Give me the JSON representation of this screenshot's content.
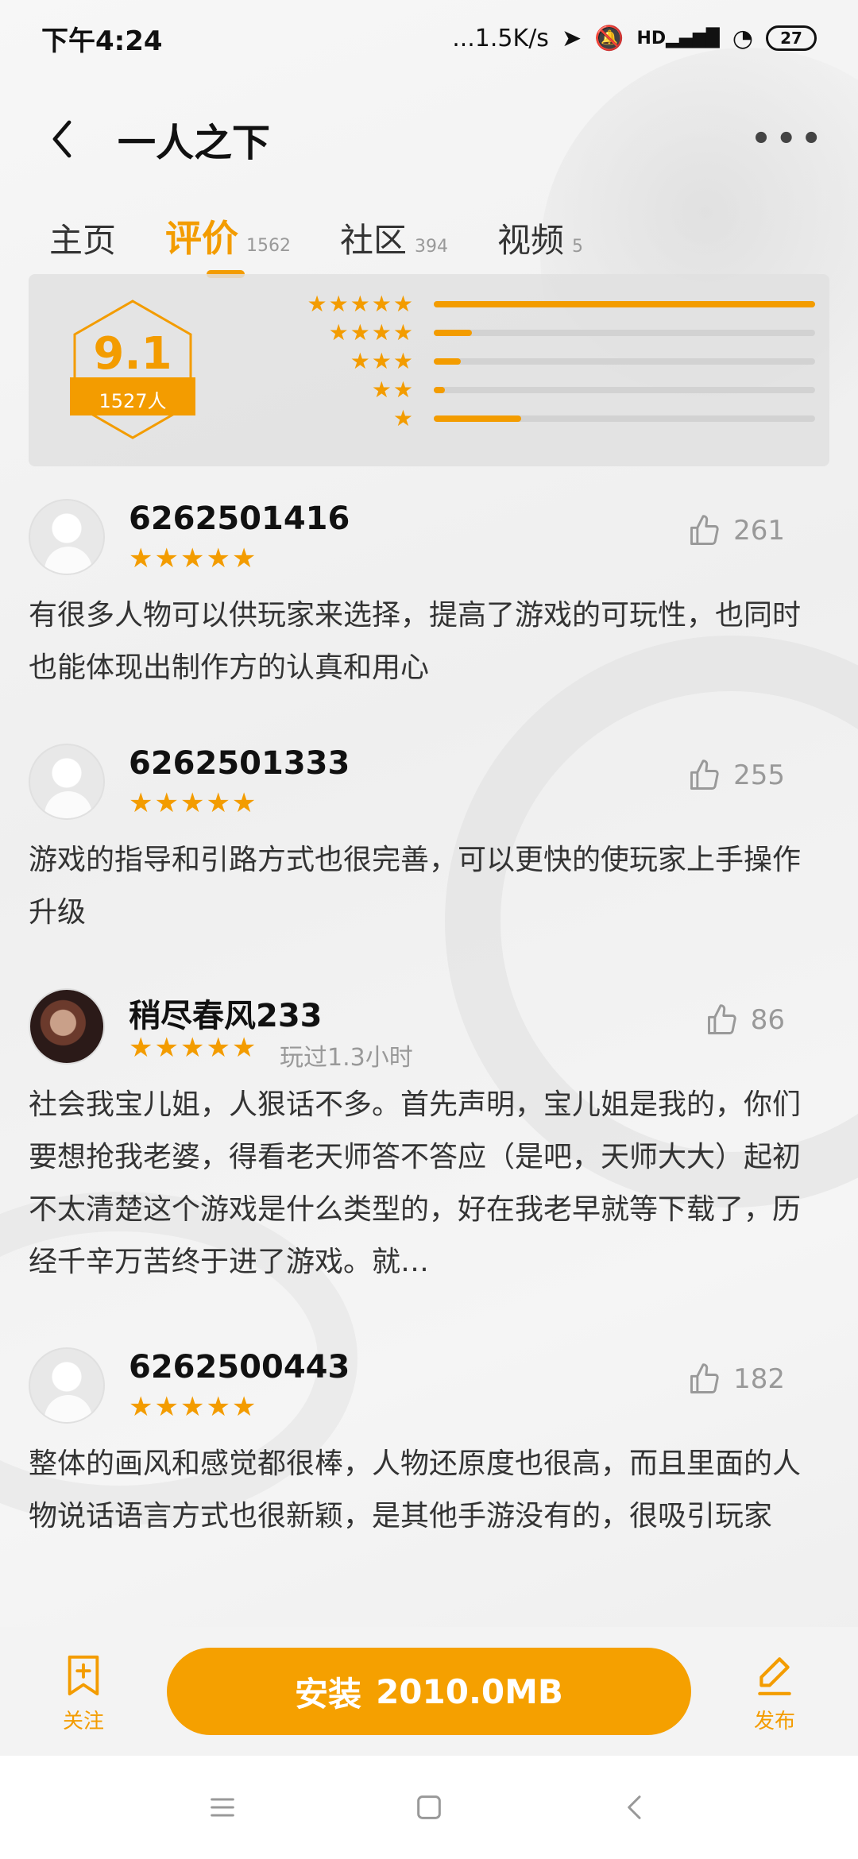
{
  "status_bar": {
    "time": "下午4:24",
    "network_speed": "...1.5K/s",
    "hd_label": "HD",
    "battery": "27",
    "icons": [
      "location-icon",
      "mute-bell-icon",
      "signal-icon",
      "wifi-icon",
      "battery-icon"
    ]
  },
  "header": {
    "title": "一人之下"
  },
  "tabs": [
    {
      "label": "主页",
      "count": ""
    },
    {
      "label": "评价",
      "count": "1562",
      "active": true
    },
    {
      "label": "社区",
      "count": "394"
    },
    {
      "label": "视频",
      "count": "5"
    }
  ],
  "rating": {
    "score": "9.1",
    "count": "1527人",
    "distribution": [
      {
        "stars": 5,
        "fraction": 1.0
      },
      {
        "stars": 4,
        "fraction": 0.1
      },
      {
        "stars": 3,
        "fraction": 0.07
      },
      {
        "stars": 2,
        "fraction": 0.03
      },
      {
        "stars": 1,
        "fraction": 0.23
      }
    ]
  },
  "reviews": [
    {
      "username": "6262501416",
      "rating": 5,
      "played": "",
      "likes": "261",
      "text": "有很多人物可以供玩家来选择，提高了游戏的可玩性，也同时也能体现出制作方的认真和用心"
    },
    {
      "username": "6262501333",
      "rating": 5,
      "played": "",
      "likes": "255",
      "text": "游戏的指导和引路方式也很完善，可以更快的使玩家上手操作升级"
    },
    {
      "username": "稍尽春风233",
      "rating": 5,
      "played": "玩过1.3小时",
      "likes": "86",
      "text": "社会我宝儿姐，人狠话不多。首先声明，宝儿姐是我的，你们要想抢我老婆，得看老天师答不答应（是吧，天师大大）起初不太清楚这个游戏是什么类型的，好在我老早就等下载了，历经千辛万苦终于进了游戏。就…"
    },
    {
      "username": "6262500443",
      "rating": 5,
      "played": "",
      "likes": "182",
      "text": "整体的画风和感觉都很棒，人物还原度也很高，而且里面的人物说话语言方式也很新颖，是其他手游没有的，很吸引玩家"
    }
  ],
  "action_bar": {
    "follow_label": "关注",
    "install_label": "安装",
    "install_size": "2010.0MB",
    "publish_label": "发布"
  },
  "colors": {
    "accent": "#f39c00",
    "install_button": "#f5a000"
  }
}
